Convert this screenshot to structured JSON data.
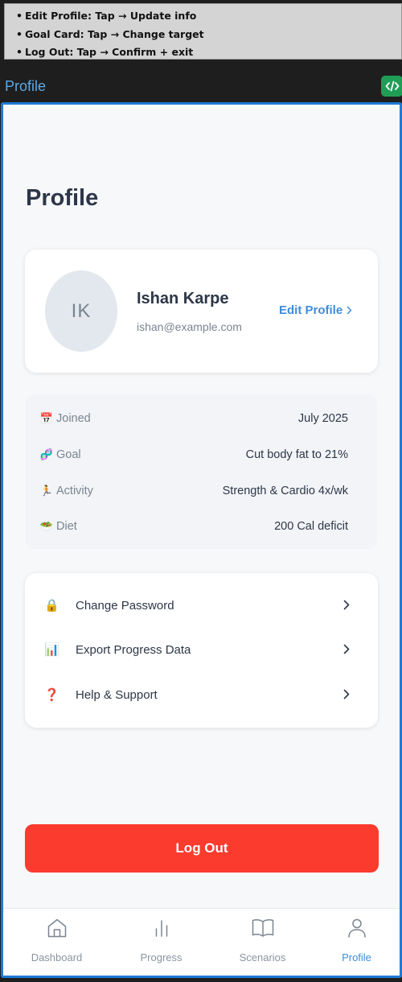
{
  "notes": [
    "Edit Profile: Tap → Update info",
    "Goal Card: Tap → Change target",
    "Log Out: Tap → Confirm + exit"
  ],
  "topbar": {
    "title": "Profile"
  },
  "page": {
    "title": "Profile"
  },
  "profile": {
    "initials": "IK",
    "name": "Ishan Karpe",
    "email": "ishan@example.com",
    "edit_label": "Edit Profile"
  },
  "info": [
    {
      "icon": "📅",
      "label": "Joined",
      "value": "July 2025"
    },
    {
      "icon": "🧬",
      "label": "Goal",
      "value": "Cut body fat to 21%"
    },
    {
      "icon": "🏃",
      "label": "Activity",
      "value": "Strength & Cardio 4x/wk"
    },
    {
      "icon": "🥗",
      "label": "Diet",
      "value": "200 Cal deficit"
    }
  ],
  "menu": [
    {
      "icon": "🔒",
      "label": "Change Password"
    },
    {
      "icon": "📊",
      "label": "Export Progress Data"
    },
    {
      "icon": "❓",
      "label": "Help & Support"
    }
  ],
  "logout_label": "Log Out",
  "tabs": [
    {
      "label": "Dashboard",
      "icon": "home-icon"
    },
    {
      "label": "Progress",
      "icon": "bar-chart-icon"
    },
    {
      "label": "Scenarios",
      "icon": "book-icon"
    },
    {
      "label": "Profile",
      "icon": "user-icon",
      "active": true
    }
  ],
  "colors": {
    "accent": "#3d8ddb",
    "danger": "#fb3b2e",
    "frame": "#1e7ad6",
    "code_button": "#1f9d55"
  }
}
